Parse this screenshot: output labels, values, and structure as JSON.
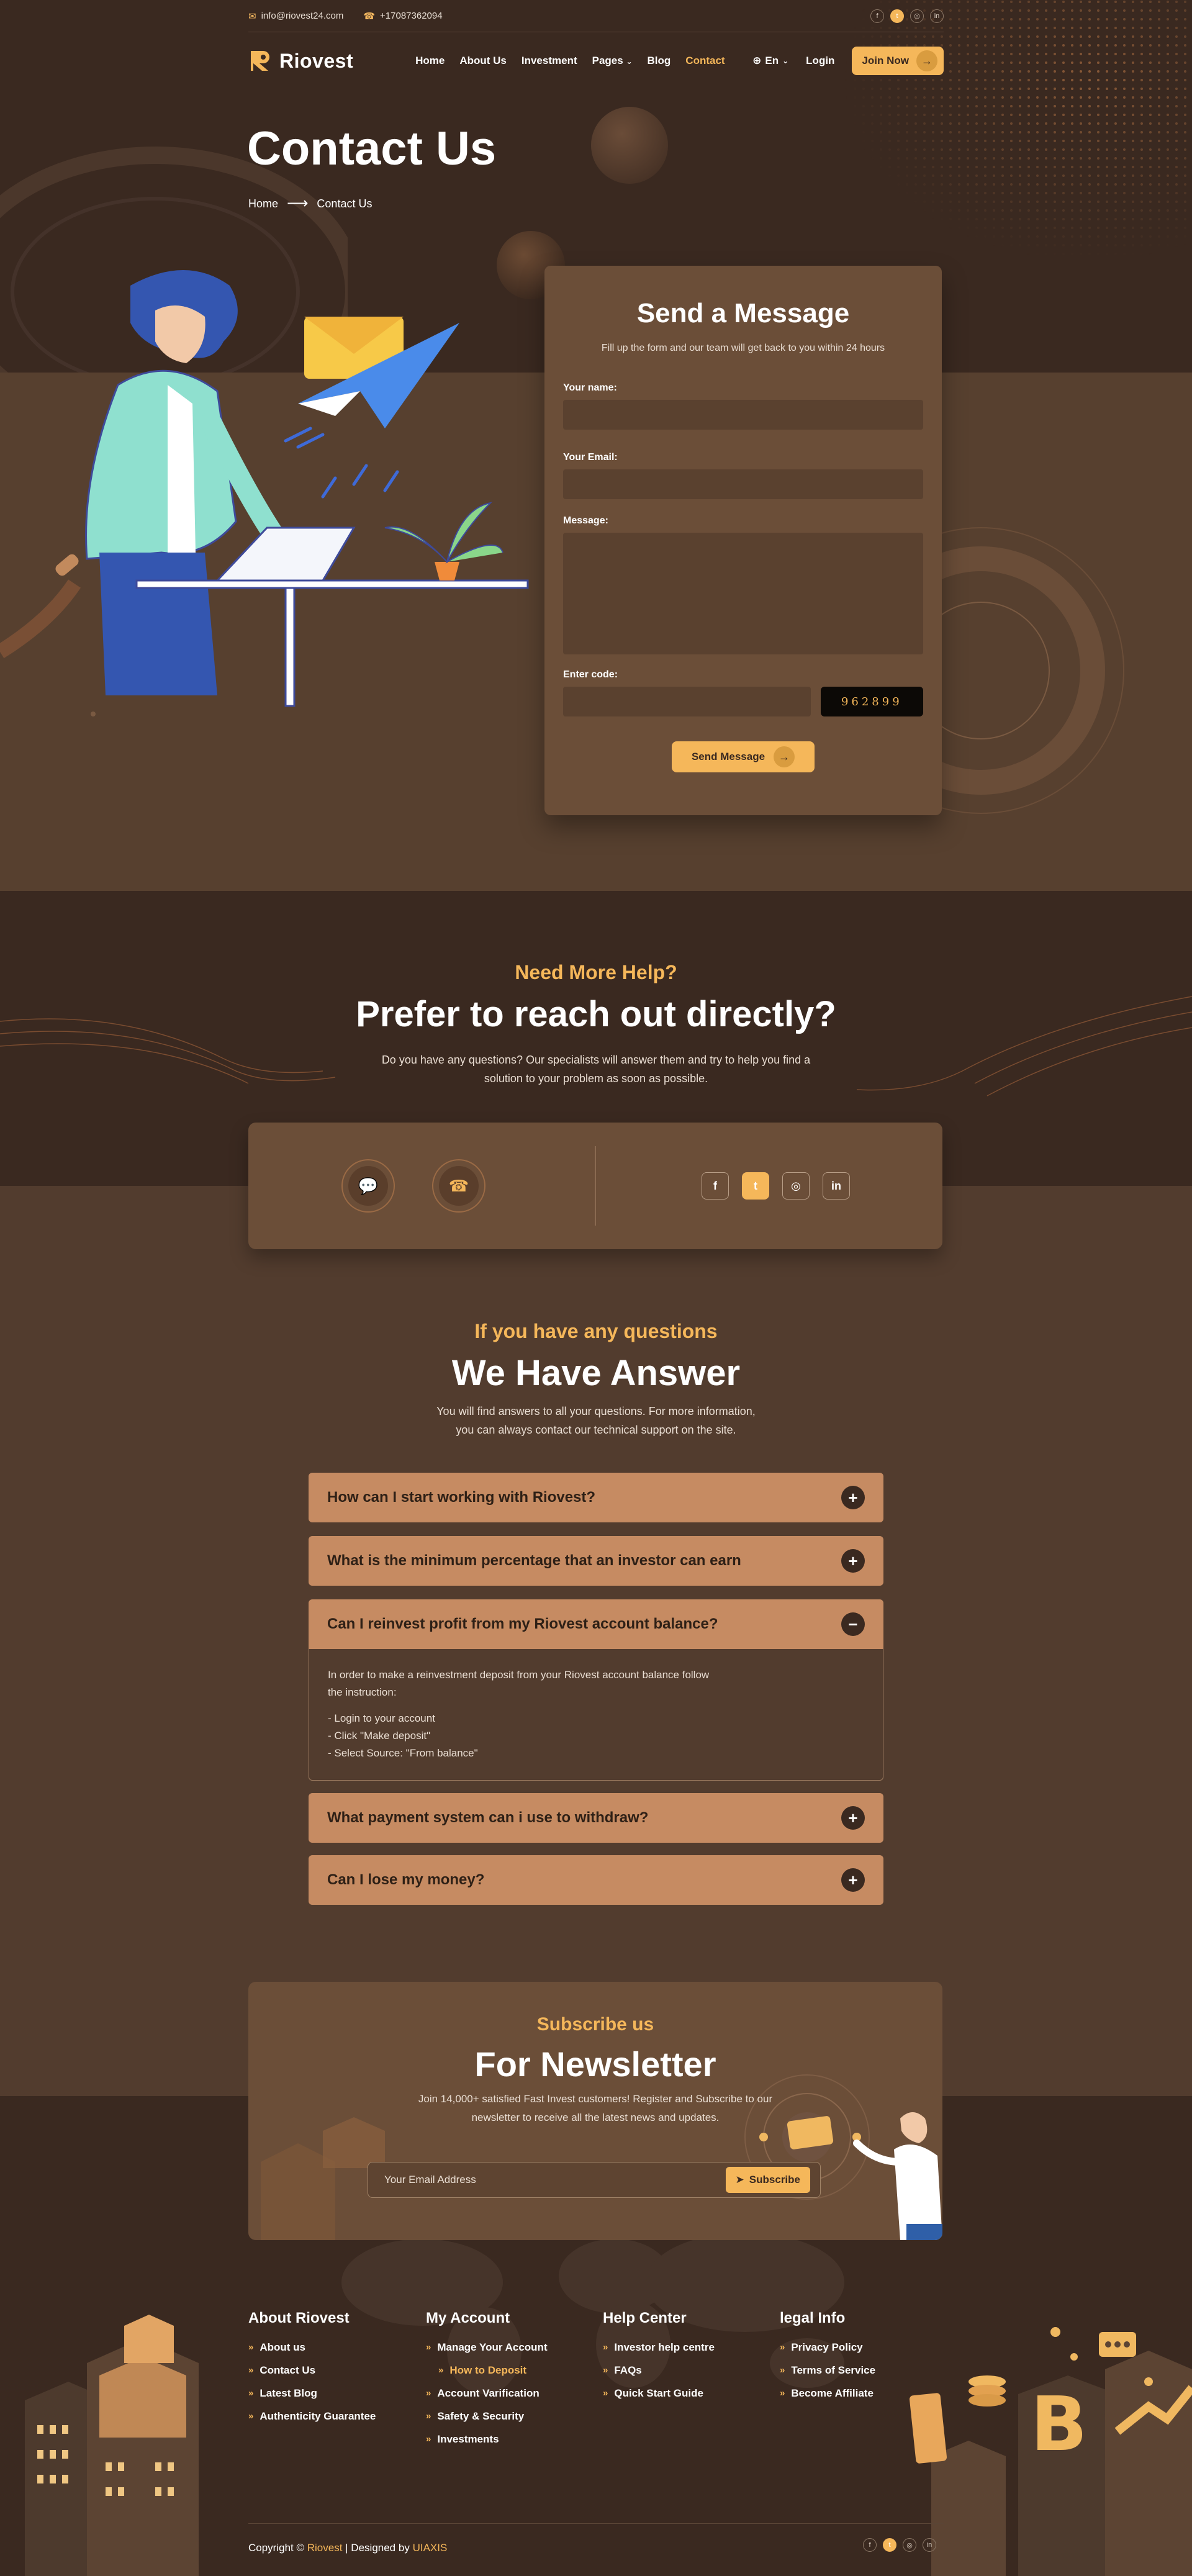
{
  "topbar": {
    "email": "info@riovest24.com",
    "phone": "+17087362094",
    "socials": [
      {
        "name": "facebook-icon",
        "glyph": "f"
      },
      {
        "name": "twitter-icon",
        "glyph": "t"
      },
      {
        "name": "instagram-icon",
        "glyph": "◎"
      },
      {
        "name": "linkedin-icon",
        "glyph": "in"
      }
    ]
  },
  "nav": {
    "logo": "Riovest",
    "links": [
      "Home",
      "About Us",
      "Investment",
      "Pages",
      "Blog",
      "Contact"
    ],
    "language": "En",
    "login": "Login",
    "join": "Join Now"
  },
  "hero": {
    "title": "Contact Us",
    "breadcrumb_home": "Home",
    "breadcrumb_current": "Contact Us"
  },
  "form": {
    "title": "Send a Message",
    "subtitle": "Fill up the form and our team will get back to you within 24 hours",
    "name_label": "Your name:",
    "email_label": "Your Email:",
    "message_label": "Message:",
    "code_label": "Enter code:",
    "captcha": "962899",
    "submit": "Send Message"
  },
  "help": {
    "eyebrow": "Need More Help?",
    "heading": "Prefer to reach out directly?",
    "text_line1": "Do you have any questions? Our specialists will answer them and try to help you find a",
    "text_line2": "solution to your problem as soon as possible."
  },
  "faq": {
    "eyebrow": "If you have any questions",
    "heading": "We Have Answer",
    "text_line1": "You will find answers to all your questions. For more information,",
    "text_line2": "you can always contact our technical support on the site.",
    "items": [
      "How can I start working with Riovest?",
      "What is the minimum percentage that an investor can earn",
      "Can I reinvest profit from my Riovest account balance?",
      "What payment system can i use to withdraw?",
      "Can I lose my money?"
    ],
    "open_answer": {
      "intro_line1": "In order to make a reinvestment deposit from your Riovest account balance follow",
      "intro_line2": "the instruction:",
      "steps": [
        "- Login to your account",
        "- Click \"Make deposit\"",
        "- Select Source: \"From balance\""
      ]
    }
  },
  "newsletter": {
    "eyebrow": "Subscribe us",
    "heading": "For Newsletter",
    "text_line1": "Join 14,000+ satisfied Fast Invest customers! Register and Subscribe to our",
    "text_line2": "newsletter to receive all the latest news and updates.",
    "placeholder": "Your Email Address",
    "button": "Subscribe"
  },
  "footer": {
    "columns": [
      {
        "title": "About Riovest",
        "links": [
          "About us",
          "Contact Us",
          "Latest Blog",
          "Authenticity Guarantee"
        ]
      },
      {
        "title": "My Account",
        "links": [
          "Manage Your Account",
          "How to Deposit",
          "Account Varification",
          "Safety & Security",
          "Investments"
        ]
      },
      {
        "title": "Help Center",
        "links": [
          "Investor help centre",
          "FAQs",
          "Quick Start Guide"
        ]
      },
      {
        "title": "legal Info",
        "links": [
          "Privacy Policy",
          "Terms of Service",
          "Become Affiliate"
        ]
      }
    ],
    "copyright_prefix": "Copyright ©",
    "brand": "Riovest",
    "designed_by": "| Designed by",
    "designer": "UIAXIS"
  },
  "colors": {
    "accent": "#f5b75a",
    "dark_bg": "#3a2920",
    "panel": "#6b4e38",
    "faq_bar": "#c68b62"
  }
}
